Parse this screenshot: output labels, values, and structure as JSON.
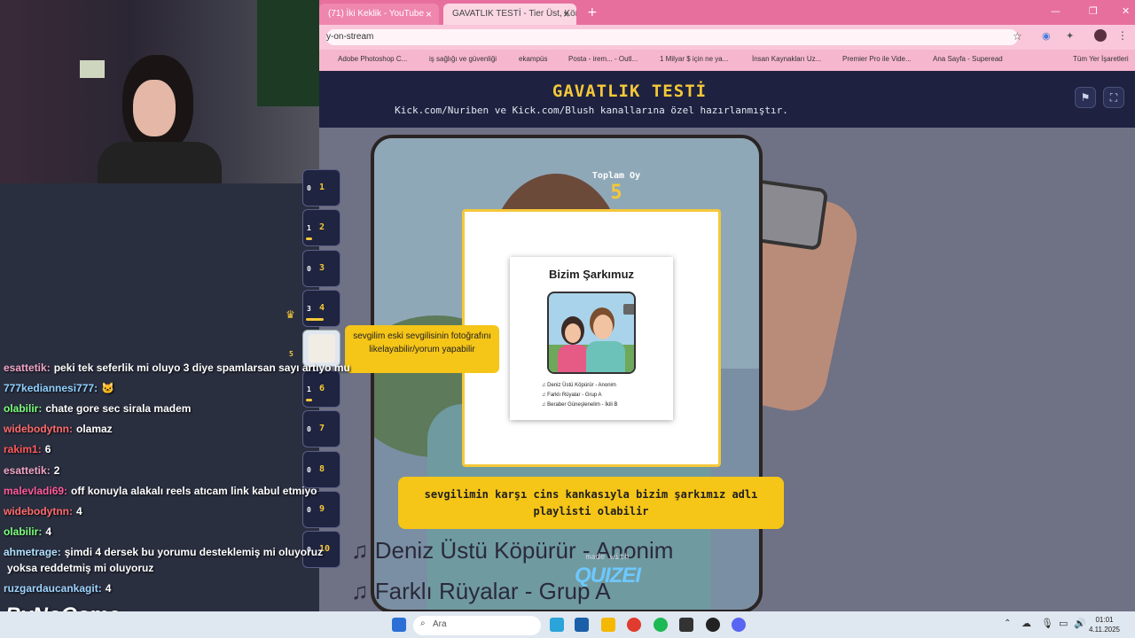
{
  "browser": {
    "tabs": [
      {
        "label": "(71) İki Keklik - YouTube"
      },
      {
        "label": "GAVATLIK TESTİ - Tier Üst, Kör"
      }
    ],
    "new_tab": "+",
    "url": "y-on-stream",
    "bookmarks": [
      "Adobe Photoshop C...",
      "iş sağlığı ve güvenliği",
      "ekampüs",
      "Posta - irem... - Outl...",
      "1 Milyar $ için ne ya...",
      "İnsan Kaynakları Uz...",
      "Premier Pro ile Vide...",
      "Ana Sayfa - Superead",
      "Tüm Yer İşaretleri"
    ]
  },
  "app": {
    "title": "GAVATLIK TESTİ",
    "subtitle": "Kick.com/Nuriben ve Kick.com/Blush kanallarına özel hazırlanmıştır.",
    "total_label": "Toplam Oy",
    "total_value": "5",
    "card": {
      "title": "Bizim Şarkımuz",
      "songs": [
        "♫ Deniz Üstü Köpürür - Anonim",
        "♫ Farklı Rüyalar - Grup A",
        "♫ Beraber Güneşlenelim - İkili B"
      ]
    },
    "caption": "sevgilimin karşı cins kankasıyla bizim şarkımız adlı playlisti olabilir",
    "bg_lines": [
      "Deniz Üstü Köpürür - Anonim",
      "Farklı Rüyalar - Grup A"
    ],
    "made_with": "made with",
    "brand": "QUIZEI",
    "tooltip": "sevgilim eski sevgilisinin fotoğrafını likelayabilir/yorum yapabilir",
    "tiers": [
      {
        "label": "1",
        "count": "0",
        "fill": 0
      },
      {
        "label": "2",
        "count": "1",
        "fill": 0.2
      },
      {
        "label": "3",
        "count": "0",
        "fill": 0
      },
      {
        "label": "4",
        "count": "3",
        "fill": 0.6
      },
      {
        "label": "",
        "count": "5",
        "fill": 1
      },
      {
        "label": "6",
        "count": "1",
        "fill": 0.2
      },
      {
        "label": "7",
        "count": "0",
        "fill": 0
      },
      {
        "label": "8",
        "count": "0",
        "fill": 0
      },
      {
        "label": "9",
        "count": "0",
        "fill": 0
      },
      {
        "label": "10",
        "count": "0",
        "fill": 0
      }
    ],
    "accent": "#f5c838"
  },
  "chat": [
    {
      "user": "esattetik:",
      "msg": "peki tek seferlik mi oluyo 3 diye spamlarsan sayı artıyo mu",
      "color": "#f2a6c8"
    },
    {
      "user": "777kediannesi777:",
      "msg": "🐱",
      "color": "#8fd0ff"
    },
    {
      "user": "olabilir:",
      "msg": "chate gore sec sirala madem",
      "color": "#7dff7d"
    },
    {
      "user": "widebodytnn:",
      "msg": "olamaz",
      "color": "#ff6b6b"
    },
    {
      "user": "rakim1:",
      "msg": "6",
      "color": "#ff5b5b"
    },
    {
      "user": "esattetik:",
      "msg": "2",
      "color": "#f2a6c8"
    },
    {
      "user": "malevladi69:",
      "msg": "off konuyla alakalı reels atıcam link kabul etmiyo",
      "color": "#ff5b9b"
    },
    {
      "user": "widebodytnn:",
      "msg": "4",
      "color": "#ff6b6b"
    },
    {
      "user": "olabilir:",
      "msg": "4",
      "color": "#7dff7d"
    },
    {
      "user": "ahmetrage:",
      "msg": "şimdi 4 dersek bu yorumu desteklemiş mi oluyoruz",
      "color": "#b0e0ff"
    },
    {
      "user": "",
      "msg": "yoksa reddetmiş mi oluyoruz",
      "color": "#ffffff"
    },
    {
      "user": "ruzgardaucankagit:",
      "msg": "4",
      "color": "#9fd4ff"
    }
  ],
  "overlay": {
    "logo": "ByNoGame"
  },
  "taskbar": {
    "search_placeholder": "Ara",
    "time": "01:01",
    "date": "4.11.2025"
  }
}
